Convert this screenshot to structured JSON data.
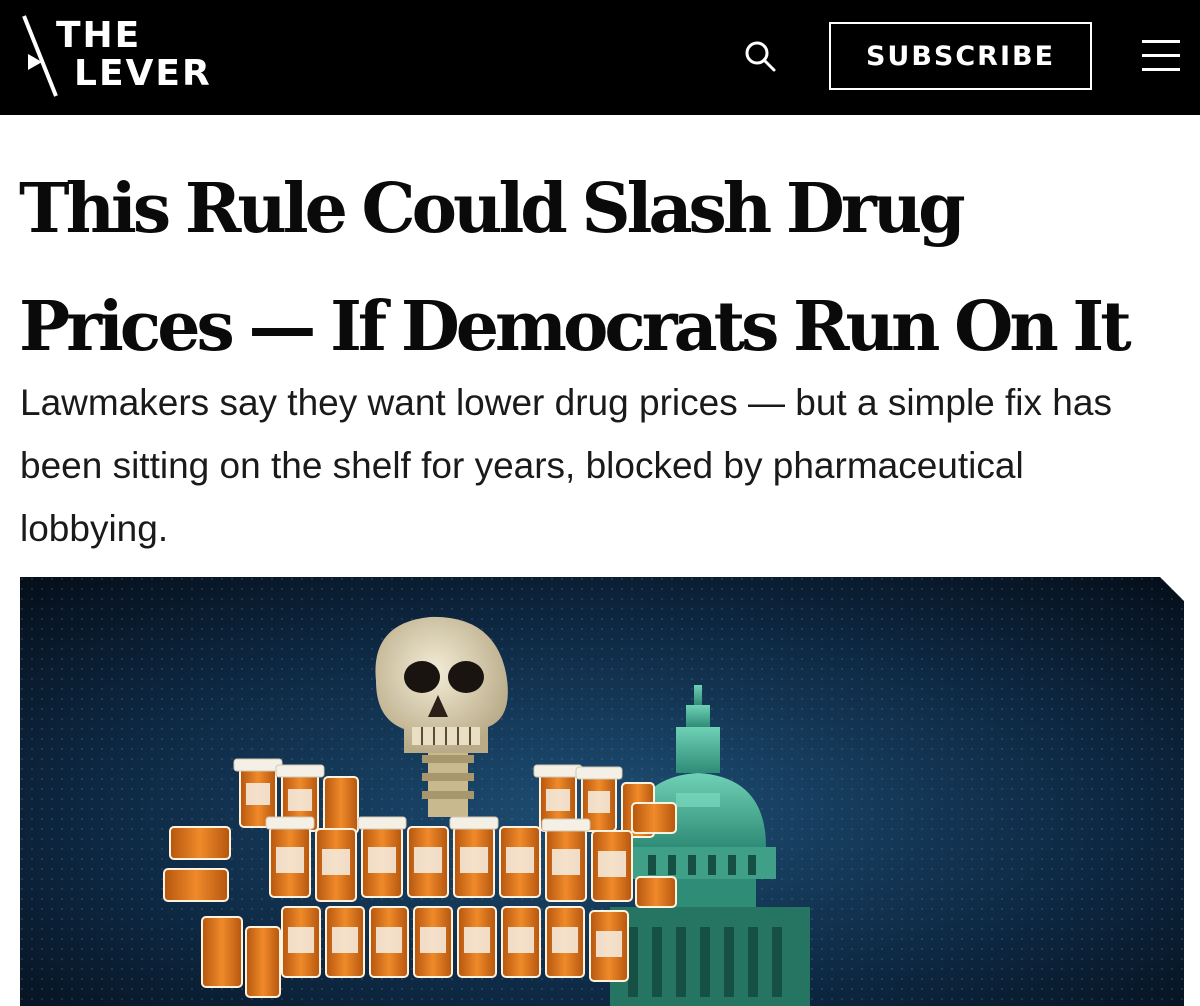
{
  "header": {
    "logo_line1": "THE",
    "logo_line2": "LEVER",
    "subscribe_label": "SUBSCRIBE",
    "search_icon": "search-icon",
    "menu_icon": "hamburger-menu-icon"
  },
  "article": {
    "headline": "This Rule Could Slash Drug Prices — If Democrats Run On It",
    "dek": "Lawmakers say they want lower drug prices — but a simple fix has been sitting on the shelf for years, blocked by pharmaceutical lobbying."
  },
  "colors": {
    "header_bg": "#000000",
    "pill_orange": "#e07a1c",
    "capitol_teal": "#4fb39a",
    "hero_bg": "#0b1f33"
  }
}
